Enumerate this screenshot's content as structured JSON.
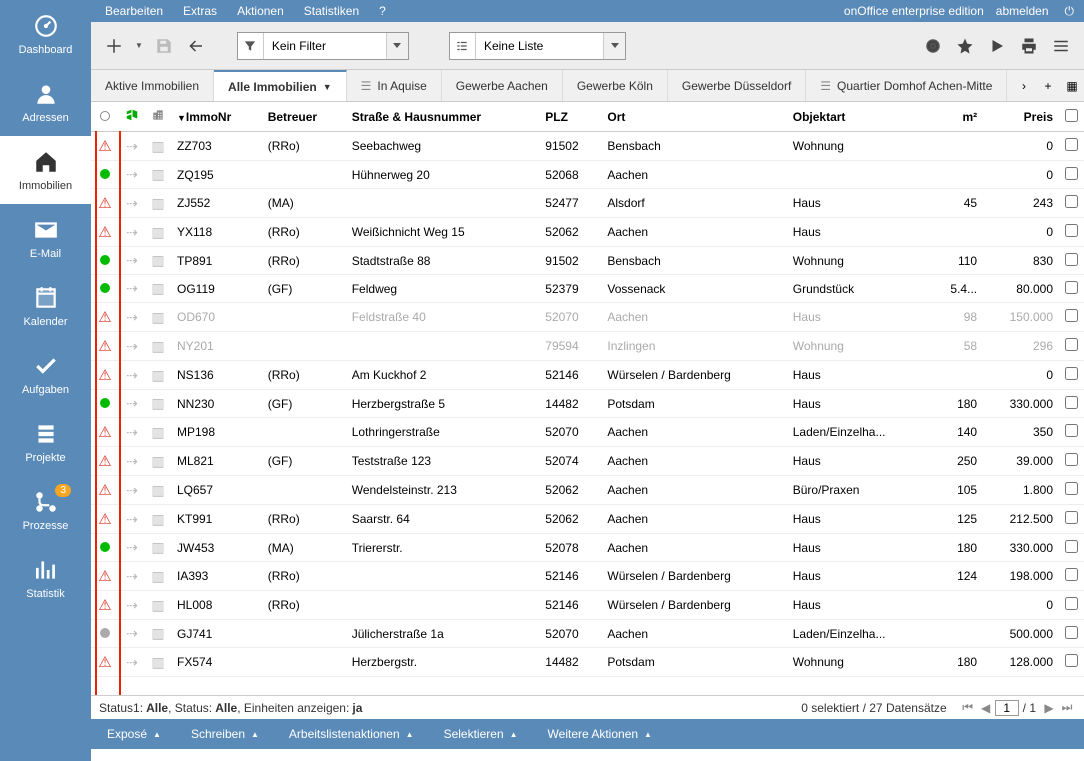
{
  "brand": "onOffice enterprise edition",
  "logout": "abmelden",
  "topMenu": [
    "Bearbeiten",
    "Extras",
    "Aktionen",
    "Statistiken",
    "?"
  ],
  "leftNav": [
    {
      "label": "Dashboard",
      "icon": "gauge"
    },
    {
      "label": "Adressen",
      "icon": "user"
    },
    {
      "label": "Immobilien",
      "icon": "home",
      "active": true
    },
    {
      "label": "E-Mail",
      "icon": "mail"
    },
    {
      "label": "Kalender",
      "icon": "calendar"
    },
    {
      "label": "Aufgaben",
      "icon": "check"
    },
    {
      "label": "Projekte",
      "icon": "stack"
    },
    {
      "label": "Prozesse",
      "icon": "branch",
      "badge": "3"
    },
    {
      "label": "Statistik",
      "icon": "stats"
    }
  ],
  "filter": {
    "label": "Kein Filter"
  },
  "list": {
    "label": "Keine Liste"
  },
  "tabs": [
    {
      "label": "Aktive Immobilien"
    },
    {
      "label": "Alle Immobilien",
      "active": true,
      "hasDropdown": true
    },
    {
      "label": "In Aquise",
      "icon": true
    },
    {
      "label": "Gewerbe Aachen"
    },
    {
      "label": "Gewerbe Köln"
    },
    {
      "label": "Gewerbe Düsseldorf"
    },
    {
      "label": "Quartier Domhof Achen-Mitte",
      "icon": true
    }
  ],
  "headers": {
    "immonr": "ImmoNr",
    "betreuer": "Betreuer",
    "strasse": "Straße & Hausnummer",
    "plz": "PLZ",
    "ort": "Ort",
    "objektart": "Objektart",
    "m2": "m²",
    "preis": "Preis"
  },
  "rows": [
    {
      "s": "warn",
      "id": "ZZ703",
      "b": "(RRo)",
      "str": "Seebachweg",
      "plz": "91502",
      "ort": "Bensbach",
      "art": "Wohnung",
      "m2": "",
      "p": "0"
    },
    {
      "s": "green",
      "id": "ZQ195",
      "b": "",
      "str": "Hühnerweg 20",
      "plz": "52068",
      "ort": "Aachen",
      "art": "",
      "m2": "",
      "p": "0"
    },
    {
      "s": "warn",
      "id": "ZJ552",
      "b": "(MA)",
      "str": "",
      "plz": "52477",
      "ort": "Alsdorf",
      "art": "Haus",
      "m2": "45",
      "p": "243"
    },
    {
      "s": "warn",
      "id": "YX118",
      "b": "(RRo)",
      "str": "Weißichnicht Weg 15",
      "plz": "52062",
      "ort": "Aachen",
      "art": "Haus",
      "m2": "",
      "p": "0"
    },
    {
      "s": "green",
      "id": "TP891",
      "b": "(RRo)",
      "str": "Stadtstraße 88",
      "plz": "91502",
      "ort": "Bensbach",
      "art": "Wohnung",
      "m2": "110",
      "p": "830"
    },
    {
      "s": "green",
      "id": "OG119",
      "b": "(GF)",
      "str": "Feldweg",
      "plz": "52379",
      "ort": "Vossenack",
      "art": "Grundstück",
      "m2": "5.4...",
      "p": "80.000"
    },
    {
      "s": "warn",
      "id": "OD670",
      "b": "",
      "str": "Feldstraße 40",
      "plz": "52070",
      "ort": "Aachen",
      "art": "Haus",
      "m2": "98",
      "p": "150.000",
      "inactive": true
    },
    {
      "s": "warn",
      "id": "NY201",
      "b": "",
      "str": "",
      "plz": "79594",
      "ort": "Inzlingen",
      "art": "Wohnung",
      "m2": "58",
      "p": "296",
      "inactive": true
    },
    {
      "s": "warn",
      "id": "NS136",
      "b": "(RRo)",
      "str": "Am Kuckhof 2",
      "plz": "52146",
      "ort": "Würselen / Bardenberg",
      "art": "Haus",
      "m2": "",
      "p": "0"
    },
    {
      "s": "green",
      "id": "NN230",
      "b": "(GF)",
      "str": "Herzbergstraße 5",
      "plz": "14482",
      "ort": "Potsdam",
      "art": "Haus",
      "m2": "180",
      "p": "330.000"
    },
    {
      "s": "warn",
      "id": "MP198",
      "b": "",
      "str": "Lothringerstraße",
      "plz": "52070",
      "ort": "Aachen",
      "art": "Laden/Einzelha...",
      "m2": "140",
      "p": "350"
    },
    {
      "s": "warn",
      "id": "ML821",
      "b": "(GF)",
      "str": "Teststraße 123",
      "plz": "52074",
      "ort": "Aachen",
      "art": "Haus",
      "m2": "250",
      "p": "39.000"
    },
    {
      "s": "warn",
      "id": "LQ657",
      "b": "",
      "str": "Wendelsteinstr. 213",
      "plz": "52062",
      "ort": "Aachen",
      "art": "Büro/Praxen",
      "m2": "105",
      "p": "1.800"
    },
    {
      "s": "warn",
      "id": "KT991",
      "b": "(RRo)",
      "str": "Saarstr. 64",
      "plz": "52062",
      "ort": "Aachen",
      "art": "Haus",
      "m2": "125",
      "p": "212.500"
    },
    {
      "s": "green",
      "id": "JW453",
      "b": "(MA)",
      "str": "Triererstr.",
      "plz": "52078",
      "ort": "Aachen",
      "art": "Haus",
      "m2": "180",
      "p": "330.000"
    },
    {
      "s": "warn",
      "id": "IA393",
      "b": "(RRo)",
      "str": "",
      "plz": "52146",
      "ort": "Würselen / Bardenberg",
      "art": "Haus",
      "m2": "124",
      "p": "198.000"
    },
    {
      "s": "warn",
      "id": "HL008",
      "b": "(RRo)",
      "str": "",
      "plz": "52146",
      "ort": "Würselen / Bardenberg",
      "art": "Haus",
      "m2": "",
      "p": "0"
    },
    {
      "s": "gray",
      "id": "GJ741",
      "b": "",
      "str": "Jülicherstraße 1a",
      "plz": "52070",
      "ort": "Aachen",
      "art": "Laden/Einzelha...",
      "m2": "",
      "p": "500.000"
    },
    {
      "s": "warn",
      "id": "FX574",
      "b": "",
      "str": "Herzbergstr.",
      "plz": "14482",
      "ort": "Potsdam",
      "art": "Wohnung",
      "m2": "180",
      "p": "128.000"
    }
  ],
  "statusBar": {
    "status1": "Status1:",
    "status1v": "Alle",
    "status": ", Status:",
    "statusv": "Alle",
    "einh": ", Einheiten anzeigen:",
    "einhv": "ja",
    "selection": "0 selektiert / 27 Datensätze",
    "page": "1",
    "totalPages": "/ 1"
  },
  "actions": [
    "Exposé",
    "Schreiben",
    "Arbeitslistenaktionen",
    "Selektieren",
    "Weitere Aktionen"
  ]
}
